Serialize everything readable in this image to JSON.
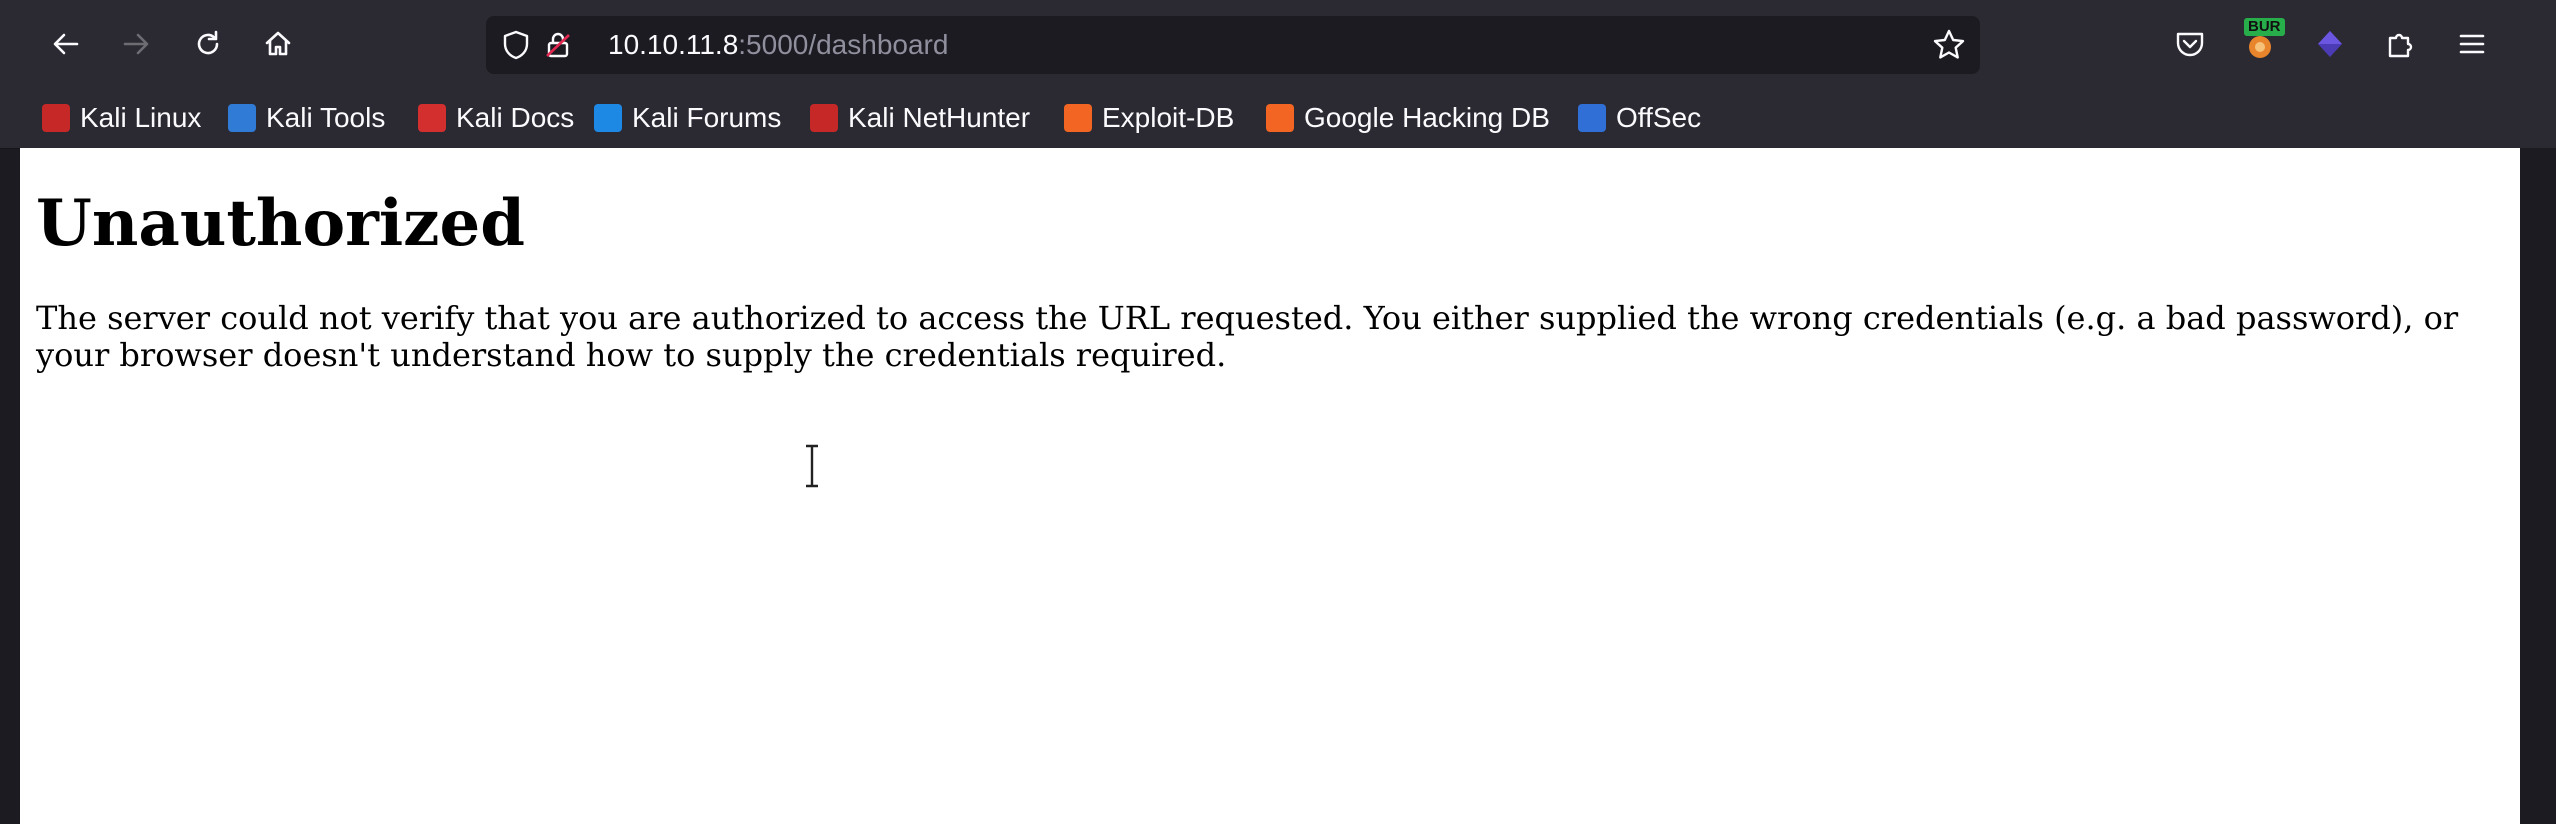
{
  "browser": {
    "url_host": "10.10.11.8",
    "url_rest": ":5000/dashboard",
    "extensions": {
      "burp_badge": "BUR"
    }
  },
  "bookmarks": [
    {
      "label": "Kali Linux",
      "icon": "kali-dragon-icon",
      "color": "#c62828"
    },
    {
      "label": "Kali Tools",
      "icon": "kali-tools-icon",
      "color": "#2f7bd6"
    },
    {
      "label": "Kali Docs",
      "icon": "kali-docs-icon",
      "color": "#d32f2f"
    },
    {
      "label": "Kali Forums",
      "icon": "kali-forums-icon",
      "color": "#1e88e5"
    },
    {
      "label": "Kali NetHunter",
      "icon": "kali-nethunter-icon",
      "color": "#c62828"
    },
    {
      "label": "Exploit-DB",
      "icon": "exploit-db-icon",
      "color": "#f26522"
    },
    {
      "label": "Google Hacking DB",
      "icon": "ghdb-icon",
      "color": "#f26522"
    },
    {
      "label": "OffSec",
      "icon": "offsec-icon",
      "color": "#2f6fd6"
    }
  ],
  "page": {
    "heading": "Unauthorized",
    "message": "The server could not verify that you are authorized to access the URL requested. You either supplied the wrong credentials (e.g. a bad password), or your browser doesn't understand how to supply the credentials required."
  },
  "colors": {
    "toolbar_bg": "#2b2a33",
    "urlbar_bg": "#1c1b22",
    "page_bg": "#ffffff"
  }
}
